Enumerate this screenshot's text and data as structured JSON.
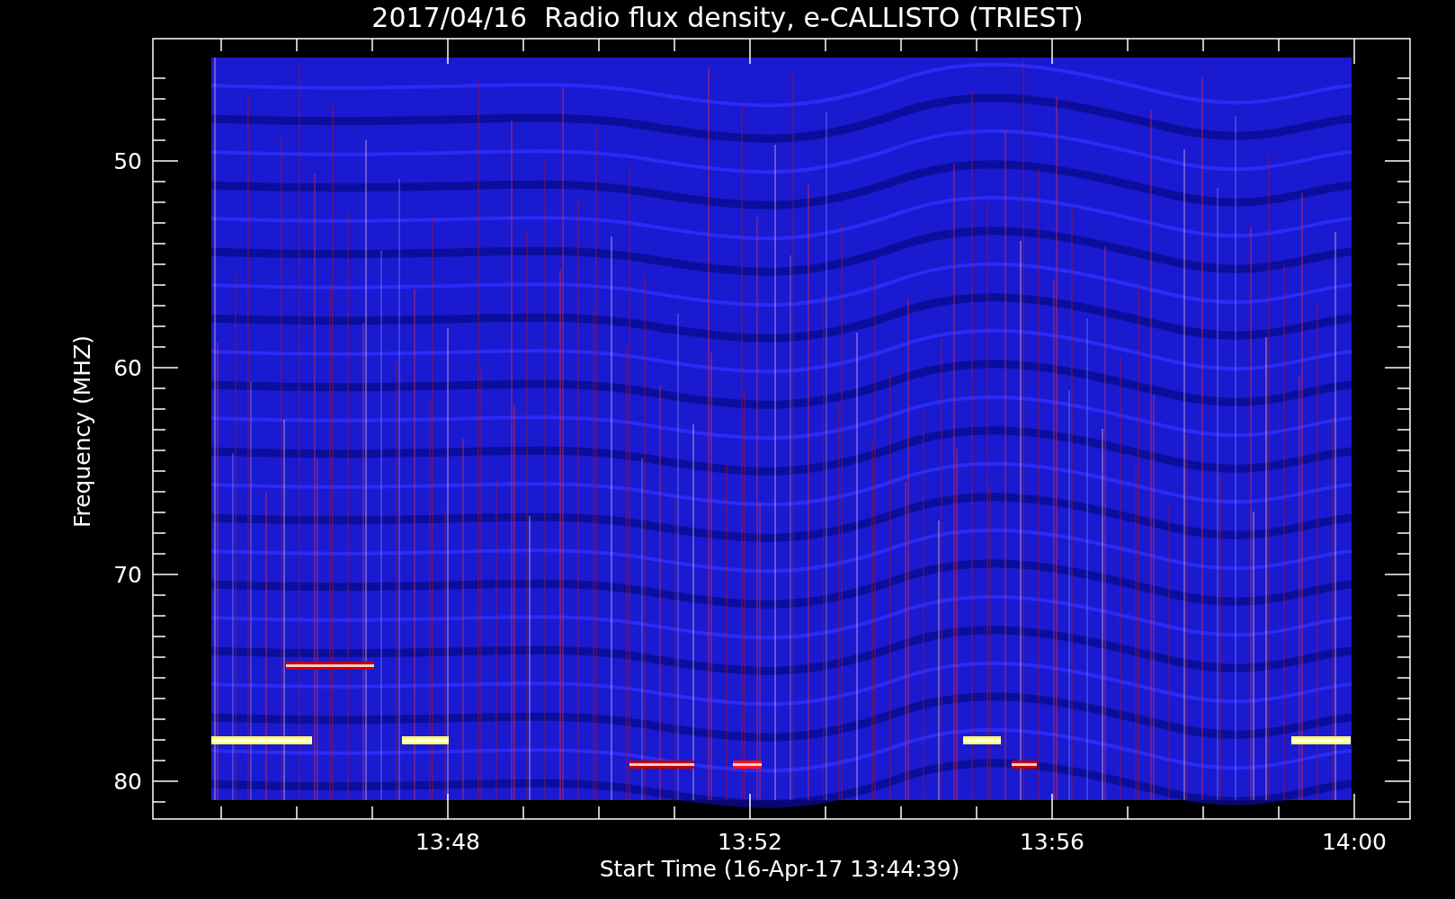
{
  "title": "2017/04/16  Radio flux density, e-CALLISTO (TRIEST)",
  "ylabel": "Frequency (MHZ)",
  "xlabel": "Start Time (16-Apr-17 13:44:39)",
  "yticks": [
    "50",
    "60",
    "70",
    "80"
  ],
  "xticks": [
    "13:48",
    "13:52",
    "13:56",
    "14:00"
  ]
}
